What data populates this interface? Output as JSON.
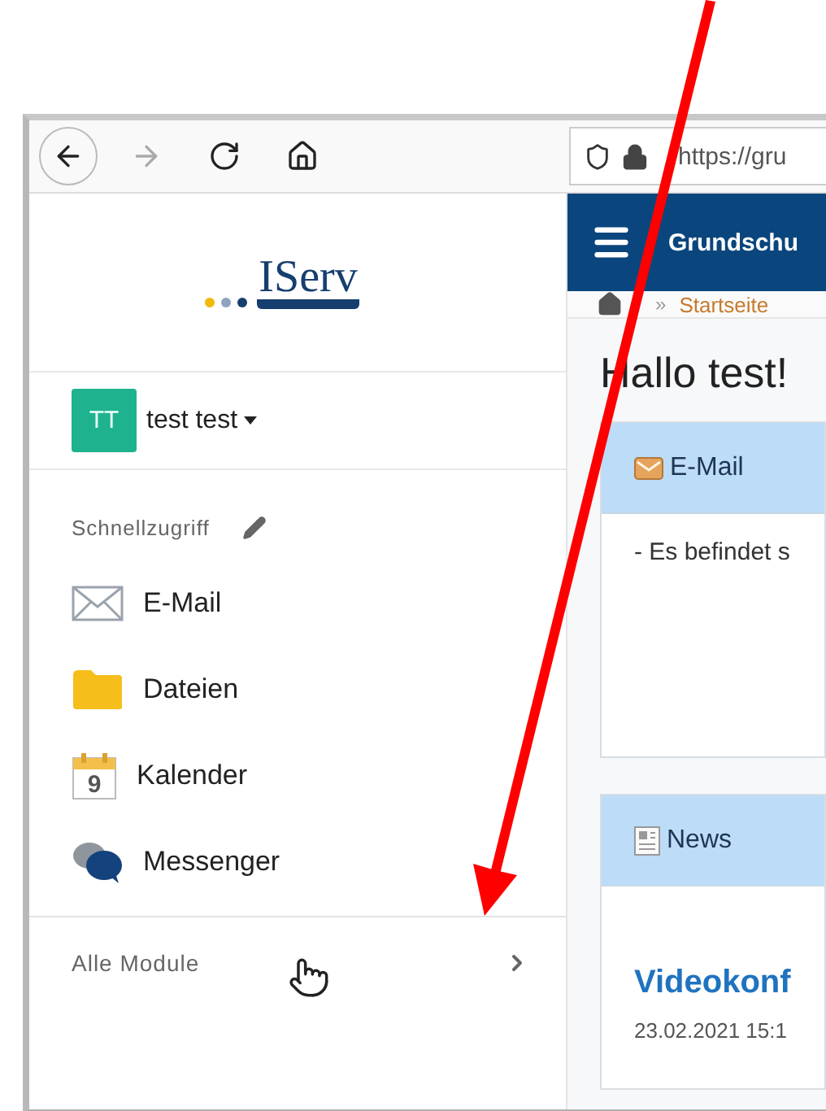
{
  "browser": {
    "url": "https://gru",
    "nav": [
      {
        "kind": "back",
        "disabled": false
      },
      {
        "kind": "forward",
        "disabled": true
      },
      {
        "kind": "reload",
        "disabled": false
      },
      {
        "kind": "home",
        "disabled": false
      }
    ]
  },
  "sidebar": {
    "logo": "IServ",
    "user": {
      "initials": "TT",
      "name": "test test"
    },
    "quick_access_label": "Schnellzugriff",
    "items": [
      {
        "kind": "mail",
        "label": "E-Mail"
      },
      {
        "kind": "files",
        "label": "Dateien"
      },
      {
        "kind": "calendar",
        "label": "Kalender",
        "day": "9"
      },
      {
        "kind": "messenger",
        "label": "Messenger"
      }
    ],
    "all_modules": "Alle Module"
  },
  "header": {
    "title": "Grundschu"
  },
  "breadcrumb": {
    "separator": "»",
    "current": "Startseite"
  },
  "greeting": "Hallo test!",
  "panels": [
    {
      "kind": "mail",
      "title": "E-Mail",
      "body": "- Es befindet s"
    },
    {
      "kind": "news",
      "title": "News",
      "headline": "Videokonf",
      "date": "23.02.2021 15:1"
    }
  ]
}
